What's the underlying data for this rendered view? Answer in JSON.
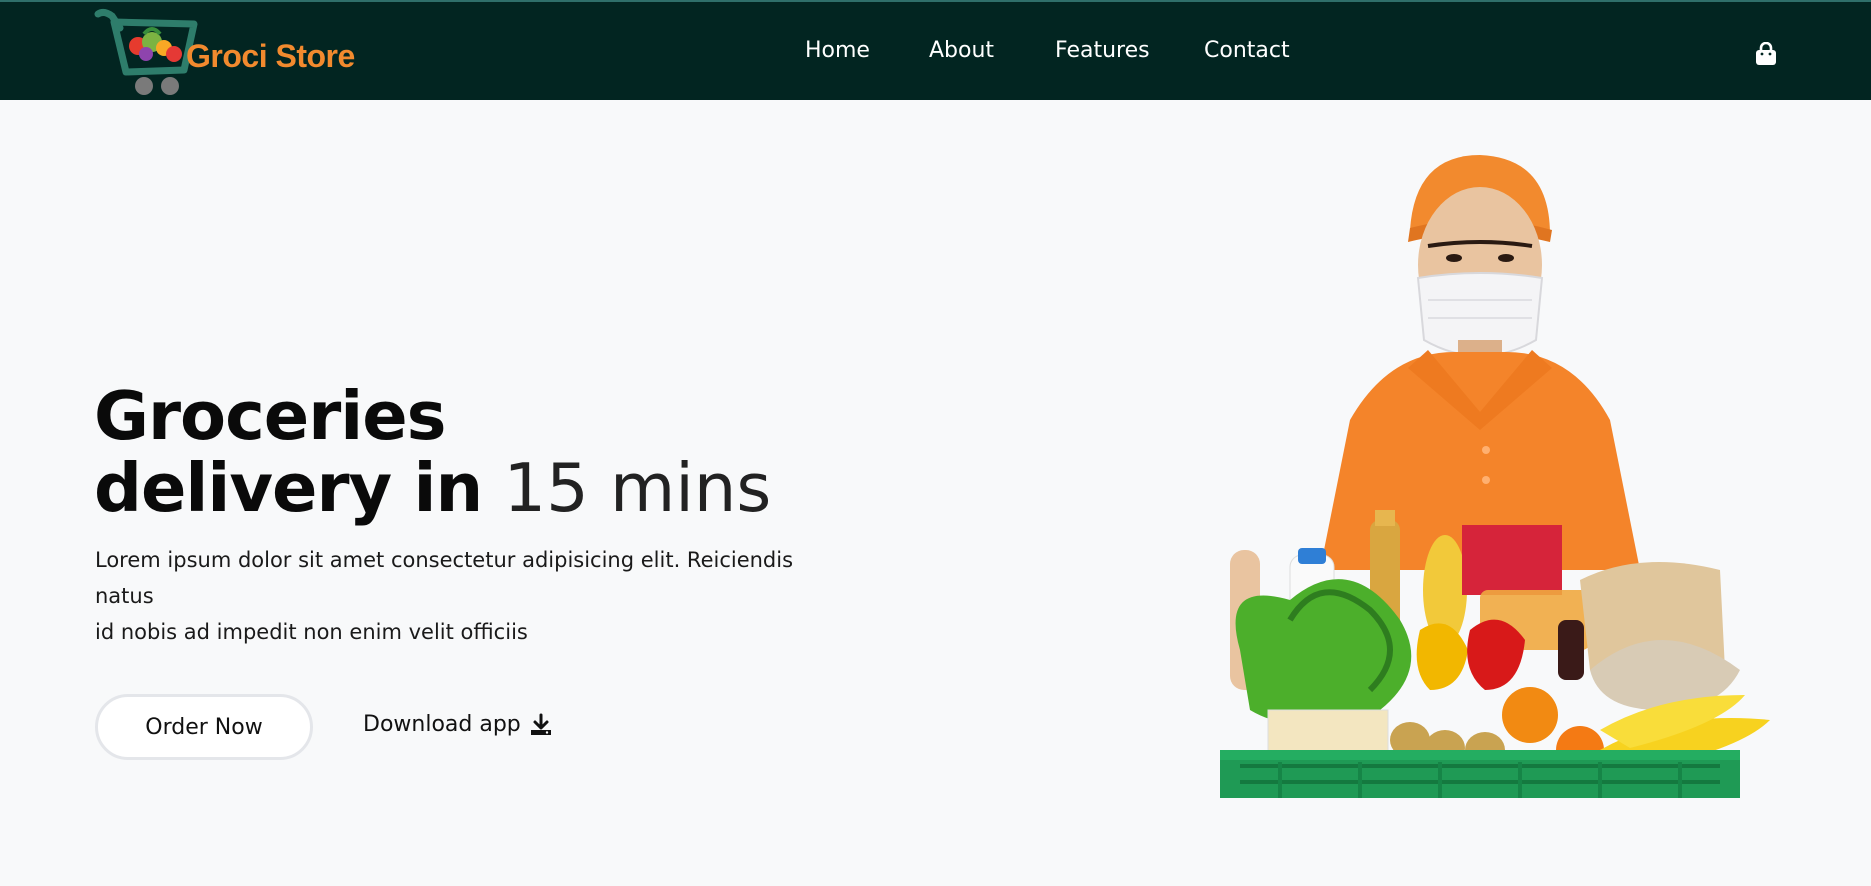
{
  "brand": {
    "name": "Groci Store",
    "logo_icon": "shopping-cart-icon"
  },
  "nav": {
    "items": [
      {
        "label": "Home"
      },
      {
        "label": "About"
      },
      {
        "label": "Features"
      },
      {
        "label": "Contact"
      }
    ],
    "cart_icon": "shopping-bag-icon"
  },
  "hero": {
    "title_line1": "Groceries",
    "title_line2_bold": "delivery in",
    "title_line2_light": " 15 mins",
    "description_line1": "Lorem ipsum dolor sit amet consectetur adipisicing elit. Reiciendis",
    "description_line2": "natus",
    "description_line3": "id nobis ad impedit non enim velit officiis",
    "order_button": "Order Now",
    "download_link": "Download app",
    "download_icon": "download-icon",
    "image_subject": "delivery-person-with-grocery-crate-image"
  },
  "colors": {
    "navbar": "#022521",
    "brand_orange": "#f28a2e",
    "background": "#f8f9fa"
  }
}
